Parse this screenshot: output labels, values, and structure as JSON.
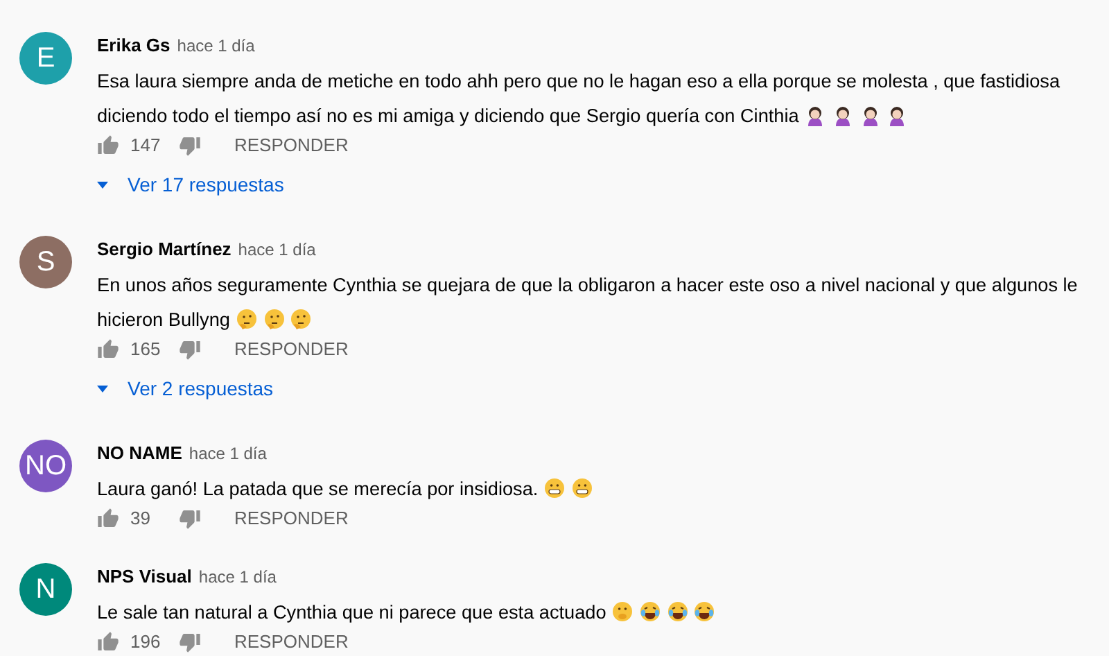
{
  "comments": [
    {
      "avatar": {
        "initials": "E",
        "color": "#1ea0aa"
      },
      "author": "Erika Gs",
      "time": "hace 1 día",
      "text": "Esa laura siempre anda de metiche en todo ahh pero que no le hagan eso a ella porque se molesta , que fastidiosa diciendo todo el tiempo así no es mi amiga y diciendo que Sergio quería con Cinthia",
      "emojis": [
        {
          "kind": "woman"
        },
        {
          "kind": "woman"
        },
        {
          "kind": "woman"
        },
        {
          "kind": "woman"
        }
      ],
      "likes": "147",
      "reply_label": "RESPONDER",
      "replies": "Ver 17 respuestas"
    },
    {
      "avatar": {
        "initials": "S",
        "color": "#8d6e63"
      },
      "author": "Sergio Martínez",
      "time": "hace 1 día",
      "text": "En unos años seguramente Cynthia se quejara de que la obligaron a hacer este oso a nivel nacional y que algunos le hicieron Bullyng",
      "emojis": [
        {
          "kind": "thinking"
        },
        {
          "kind": "thinking"
        },
        {
          "kind": "thinking"
        }
      ],
      "likes": "165",
      "reply_label": "RESPONDER",
      "replies": "Ver 2 respuestas"
    },
    {
      "avatar": {
        "initials": "NO",
        "color": "#7e57c2"
      },
      "author": "NO NAME",
      "time": "hace 1 día",
      "text": "Laura ganó! La patada que se merecía por insidiosa.",
      "emojis": [
        {
          "kind": "grimace"
        },
        {
          "kind": "grimace"
        }
      ],
      "likes": "39",
      "reply_label": "RESPONDER"
    },
    {
      "avatar": {
        "initials": "N",
        "color": "#00897b"
      },
      "author": "NPS Visual",
      "time": "hace 1 día",
      "text": "Le sale tan natural a Cynthia que ni parece que esta actuado",
      "emojis": [
        {
          "kind": "shush"
        },
        {
          "kind": "laughing"
        },
        {
          "kind": "laughing"
        },
        {
          "kind": "laughing"
        }
      ],
      "likes": "196",
      "reply_label": "RESPONDER"
    }
  ]
}
